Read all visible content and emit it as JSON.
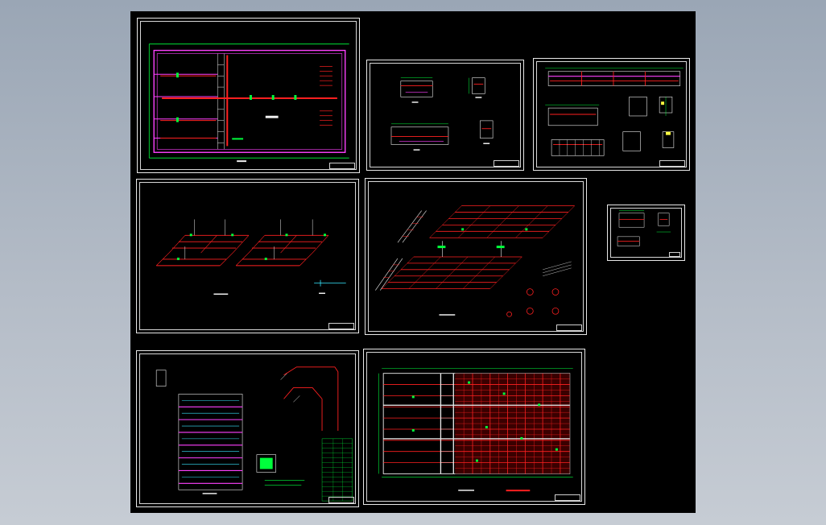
{
  "viewport": {
    "name": "cad-model-space",
    "background": "#000000",
    "surround": "#a9b3c0"
  },
  "colors": {
    "frame": "#ffffff",
    "red": "#ff2020",
    "green": "#00ff3c",
    "magenta": "#ff40ff",
    "cyan": "#38e8ff",
    "yellow": "#ffff40",
    "white": "#f0f0f0"
  },
  "sheets": [
    {
      "id": "sheet-1",
      "content": "floor-plan-with-pipes"
    },
    {
      "id": "sheet-2",
      "content": "small-sections"
    },
    {
      "id": "sheet-3",
      "content": "elevations-and-sections"
    },
    {
      "id": "sheet-4",
      "content": "two-isometric-pipe-grids"
    },
    {
      "id": "sheet-5",
      "content": "large-isometric-pipe-grid"
    },
    {
      "id": "sheet-6",
      "content": "mini-detail"
    },
    {
      "id": "sheet-7",
      "content": "pipe-system-diagram-with-table"
    },
    {
      "id": "sheet-8",
      "content": "dense-grid-plan"
    }
  ]
}
